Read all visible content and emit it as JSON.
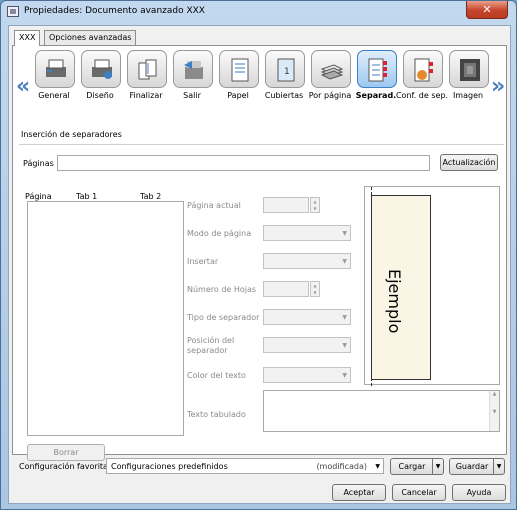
{
  "window": {
    "title": "Propiedades: Documento avanzado XXX",
    "close_label": "✕"
  },
  "tabs": [
    {
      "label": "XXX"
    },
    {
      "label": "Opciones avanzadas"
    }
  ],
  "nav": {
    "left": "«",
    "right": "»"
  },
  "toolbar": [
    {
      "label": "General",
      "icon": "general-icon"
    },
    {
      "label": "Diseño",
      "icon": "layout-icon"
    },
    {
      "label": "Finalizar",
      "icon": "finish-icon"
    },
    {
      "label": "Salir",
      "icon": "output-tray-icon"
    },
    {
      "label": "Papel",
      "icon": "paper-icon"
    },
    {
      "label": "Cubiertas",
      "icon": "cover-icon"
    },
    {
      "label": "Por página",
      "icon": "per-page-icon"
    },
    {
      "label": "Separad.",
      "icon": "tab-separator-icon",
      "selected": true
    },
    {
      "label": "Conf. de sep.",
      "icon": "separator-config-icon"
    },
    {
      "label": "Imagen",
      "icon": "image-icon"
    }
  ],
  "section": {
    "title": "Inserción de separadores"
  },
  "pages": {
    "label": "Páginas",
    "value": "",
    "update_button": "Actualización"
  },
  "list": {
    "col_page": "Página",
    "col_tab1": "Tab 1",
    "col_tab2": "Tab 2",
    "delete_button": "Borrar"
  },
  "fields": {
    "current_page": "Página actual",
    "page_mode": "Modo de página",
    "insert": "Insertar",
    "sheet_count": "Número de Hojas",
    "separator_type": "Tipo de separador",
    "separator_position_1": "Posición del",
    "separator_position_2": "separador",
    "text_color": "Color del texto",
    "tab_text": "Texto tabulado"
  },
  "preview": {
    "sample_text": "Ejemplo"
  },
  "favorites": {
    "label": "Configuración favorita",
    "value": "Configuraciones predefinidos",
    "modified": "(modificada)",
    "load_button": "Cargar",
    "save_button": "Guardar"
  },
  "footer": {
    "ok": "Aceptar",
    "cancel": "Cancelar",
    "help": "Ayuda"
  },
  "colors": {
    "accent": "#3c7fc4",
    "title_bar": "#b3cde8",
    "close": "#c7442c"
  }
}
